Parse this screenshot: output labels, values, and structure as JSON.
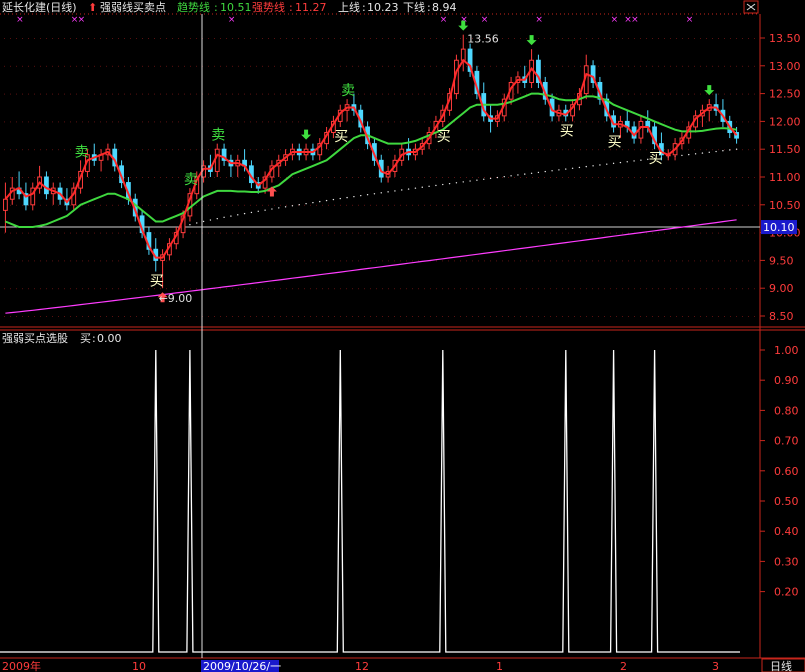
{
  "header": {
    "stock_title": "延长化建(日线)",
    "indicator_name": "强弱线买卖点",
    "trend_label": "趋势线",
    "trend_value": "10.51",
    "strong_label": "强势线",
    "strong_value": "11.27",
    "upper_label": "上线",
    "upper_value": "10.23",
    "lower_label": "下线",
    "lower_value": "8.94"
  },
  "lower_header": {
    "indicator_name": "强弱买点选股",
    "buy_label": "买",
    "buy_value": "0.00"
  },
  "bottom_bar": {
    "x_labels": [
      "2009年",
      "10",
      "2009/10/26/一",
      "12",
      "1",
      "2",
      "3"
    ],
    "period_label": "日线"
  },
  "colors": {
    "background": "#000000",
    "axis": "#c8261c",
    "up_candle": "#ff3c3c",
    "down_candle": "#4fd8ff",
    "trend_line": "#3fd83f",
    "strong_line": "#ff2a2a",
    "long_ma": "#ff3cff",
    "signal_line": "#ffffff",
    "buy_text": "#ffffc8",
    "sell_text": "#40e040"
  },
  "chart_data": [
    {
      "type": "candlestick",
      "ylim": [
        8.3,
        13.7
      ],
      "y_ticks": [
        "13.50",
        "13.00",
        "12.50",
        "12.00",
        "11.50",
        "11.00",
        "10.50",
        "10.00",
        "9.50",
        "9.00",
        "8.50"
      ],
      "current_price_label": "10.10",
      "annotations": {
        "high_label": "13.56",
        "low_label": "9.00",
        "sell_label": "卖",
        "buy_label": "买"
      },
      "ohlc": [
        [
          10.4,
          10.9,
          10.0,
          10.6
        ],
        [
          10.6,
          11.0,
          10.5,
          10.8
        ],
        [
          10.8,
          11.1,
          10.6,
          10.7
        ],
        [
          10.7,
          10.9,
          10.4,
          10.5
        ],
        [
          10.5,
          10.9,
          10.4,
          10.8
        ],
        [
          10.8,
          11.2,
          10.7,
          11.0
        ],
        [
          11.0,
          11.1,
          10.6,
          10.7
        ],
        [
          10.7,
          10.9,
          10.5,
          10.8
        ],
        [
          10.8,
          10.9,
          10.5,
          10.6
        ],
        [
          10.6,
          10.8,
          10.4,
          10.5
        ],
        [
          10.5,
          10.9,
          10.4,
          10.8
        ],
        [
          10.8,
          11.3,
          10.7,
          11.1
        ],
        [
          11.1,
          11.5,
          11.0,
          11.4
        ],
        [
          11.4,
          11.6,
          11.2,
          11.3
        ],
        [
          11.3,
          11.5,
          11.1,
          11.4
        ],
        [
          11.4,
          11.6,
          11.3,
          11.5
        ],
        [
          11.5,
          11.6,
          11.1,
          11.2
        ],
        [
          11.2,
          11.3,
          10.8,
          10.9
        ],
        [
          10.9,
          11.0,
          10.5,
          10.6
        ],
        [
          10.6,
          10.7,
          10.2,
          10.3
        ],
        [
          10.3,
          10.4,
          9.9,
          10.0
        ],
        [
          10.0,
          10.1,
          9.6,
          9.7
        ],
        [
          9.7,
          9.9,
          9.3,
          9.5
        ],
        [
          9.5,
          9.7,
          9.0,
          9.6
        ],
        [
          9.6,
          9.9,
          9.5,
          9.8
        ],
        [
          9.8,
          10.1,
          9.7,
          10.0
        ],
        [
          10.0,
          10.4,
          9.9,
          10.3
        ],
        [
          10.3,
          10.8,
          10.2,
          10.7
        ],
        [
          10.7,
          11.1,
          10.6,
          11.0
        ],
        [
          11.0,
          11.3,
          10.9,
          11.2
        ],
        [
          11.2,
          11.4,
          11.0,
          11.1
        ],
        [
          11.1,
          11.6,
          11.0,
          11.5
        ],
        [
          11.5,
          11.6,
          11.2,
          11.3
        ],
        [
          11.3,
          11.4,
          11.0,
          11.2
        ],
        [
          11.2,
          11.4,
          11.0,
          11.3
        ],
        [
          11.3,
          11.5,
          11.1,
          11.2
        ],
        [
          11.2,
          11.3,
          10.8,
          10.9
        ],
        [
          10.9,
          11.0,
          10.7,
          10.8
        ],
        [
          10.8,
          11.1,
          10.7,
          11.0
        ],
        [
          11.0,
          11.3,
          10.9,
          11.2
        ],
        [
          11.2,
          11.4,
          11.0,
          11.3
        ],
        [
          11.3,
          11.5,
          11.2,
          11.4
        ],
        [
          11.4,
          11.6,
          11.3,
          11.5
        ],
        [
          11.5,
          11.6,
          11.3,
          11.4
        ],
        [
          11.4,
          11.6,
          11.3,
          11.5
        ],
        [
          11.5,
          11.6,
          11.3,
          11.4
        ],
        [
          11.4,
          11.7,
          11.3,
          11.6
        ],
        [
          11.6,
          11.9,
          11.5,
          11.8
        ],
        [
          11.8,
          12.1,
          11.7,
          12.0
        ],
        [
          12.0,
          12.3,
          11.9,
          12.2
        ],
        [
          12.2,
          12.4,
          12.0,
          12.3
        ],
        [
          12.3,
          12.5,
          12.1,
          12.2
        ],
        [
          12.2,
          12.3,
          11.8,
          11.9
        ],
        [
          11.9,
          12.0,
          11.5,
          11.6
        ],
        [
          11.6,
          11.7,
          11.2,
          11.3
        ],
        [
          11.3,
          11.4,
          10.9,
          11.0
        ],
        [
          11.0,
          11.2,
          10.9,
          11.1
        ],
        [
          11.1,
          11.4,
          11.0,
          11.3
        ],
        [
          11.3,
          11.6,
          11.2,
          11.5
        ],
        [
          11.5,
          11.7,
          11.3,
          11.4
        ],
        [
          11.4,
          11.6,
          11.3,
          11.5
        ],
        [
          11.5,
          11.7,
          11.4,
          11.6
        ],
        [
          11.6,
          11.9,
          11.5,
          11.8
        ],
        [
          11.8,
          12.1,
          11.7,
          12.0
        ],
        [
          12.0,
          12.3,
          11.9,
          12.2
        ],
        [
          12.2,
          12.6,
          12.1,
          12.5
        ],
        [
          12.5,
          13.2,
          12.4,
          13.1
        ],
        [
          13.1,
          13.56,
          12.9,
          13.3
        ],
        [
          13.3,
          13.4,
          12.8,
          12.9
        ],
        [
          12.9,
          13.0,
          12.4,
          12.5
        ],
        [
          12.5,
          12.7,
          12.0,
          12.1
        ],
        [
          12.1,
          12.3,
          11.8,
          12.0
        ],
        [
          12.0,
          12.2,
          11.9,
          12.1
        ],
        [
          12.1,
          12.5,
          12.0,
          12.4
        ],
        [
          12.4,
          12.8,
          12.3,
          12.7
        ],
        [
          12.7,
          12.9,
          12.5,
          12.8
        ],
        [
          12.8,
          13.0,
          12.6,
          12.7
        ],
        [
          12.7,
          13.3,
          12.6,
          13.1
        ],
        [
          13.1,
          13.2,
          12.6,
          12.7
        ],
        [
          12.7,
          12.8,
          12.3,
          12.4
        ],
        [
          12.4,
          12.5,
          12.0,
          12.1
        ],
        [
          12.1,
          12.3,
          12.0,
          12.2
        ],
        [
          12.2,
          12.3,
          12.0,
          12.1
        ],
        [
          12.1,
          12.4,
          12.0,
          12.3
        ],
        [
          12.3,
          12.6,
          12.2,
          12.5
        ],
        [
          12.5,
          13.2,
          12.4,
          13.0
        ],
        [
          13.0,
          13.1,
          12.6,
          12.7
        ],
        [
          12.7,
          12.8,
          12.3,
          12.4
        ],
        [
          12.4,
          12.5,
          12.0,
          12.1
        ],
        [
          12.1,
          12.2,
          11.8,
          11.9
        ],
        [
          11.9,
          12.1,
          11.7,
          12.0
        ],
        [
          12.0,
          12.2,
          11.8,
          11.9
        ],
        [
          11.9,
          12.0,
          11.6,
          11.7
        ],
        [
          11.7,
          12.1,
          11.6,
          12.0
        ],
        [
          12.0,
          12.2,
          11.8,
          11.9
        ],
        [
          11.9,
          12.0,
          11.5,
          11.6
        ],
        [
          11.6,
          11.8,
          11.3,
          11.4
        ],
        [
          11.4,
          11.5,
          11.3,
          11.4
        ],
        [
          11.4,
          11.7,
          11.3,
          11.6
        ],
        [
          11.6,
          11.8,
          11.5,
          11.7
        ],
        [
          11.7,
          12.0,
          11.6,
          11.9
        ],
        [
          11.9,
          12.2,
          11.8,
          12.1
        ],
        [
          12.1,
          12.3,
          11.9,
          12.2
        ],
        [
          12.2,
          12.4,
          12.0,
          12.3
        ],
        [
          12.3,
          12.5,
          12.1,
          12.2
        ],
        [
          12.2,
          12.4,
          11.9,
          12.0
        ],
        [
          12.0,
          12.1,
          11.7,
          11.8
        ],
        [
          11.8,
          11.9,
          11.6,
          11.7
        ]
      ],
      "trend_line": [
        10.2,
        10.15,
        10.1,
        10.1,
        10.1,
        10.12,
        10.15,
        10.2,
        10.25,
        10.3,
        10.4,
        10.5,
        10.55,
        10.6,
        10.65,
        10.7,
        10.7,
        10.65,
        10.6,
        10.5,
        10.4,
        10.3,
        10.2,
        10.2,
        10.25,
        10.3,
        10.35,
        10.45,
        10.55,
        10.65,
        10.7,
        10.75,
        10.75,
        10.75,
        10.74,
        10.74,
        10.73,
        10.73,
        10.75,
        10.8,
        10.85,
        10.95,
        11.05,
        11.1,
        11.15,
        11.2,
        11.25,
        11.3,
        11.4,
        11.5,
        11.6,
        11.7,
        11.75,
        11.75,
        11.7,
        11.65,
        11.6,
        11.6,
        11.6,
        11.62,
        11.65,
        11.7,
        11.75,
        11.8,
        11.85,
        11.95,
        12.05,
        12.15,
        12.25,
        12.3,
        12.3,
        12.3,
        12.3,
        12.32,
        12.35,
        12.4,
        12.45,
        12.5,
        12.5,
        12.48,
        12.45,
        12.4,
        12.38,
        12.38,
        12.4,
        12.45,
        12.45,
        12.42,
        12.38,
        12.3,
        12.25,
        12.2,
        12.15,
        12.1,
        12.05,
        12.0,
        11.95,
        11.9,
        11.85,
        11.82,
        11.82,
        11.82,
        11.83,
        11.85,
        11.87,
        11.88,
        11.87,
        11.85
      ],
      "strong_line": [
        10.6,
        10.75,
        10.8,
        10.65,
        10.7,
        10.9,
        10.8,
        10.75,
        10.7,
        10.55,
        10.7,
        11.0,
        11.3,
        11.35,
        11.4,
        11.45,
        11.3,
        11.0,
        10.7,
        10.4,
        10.05,
        9.75,
        9.55,
        9.55,
        9.75,
        9.95,
        10.25,
        10.6,
        10.95,
        11.15,
        11.15,
        11.4,
        11.35,
        11.25,
        11.25,
        11.2,
        11.0,
        10.85,
        10.95,
        11.15,
        11.25,
        11.35,
        11.45,
        11.45,
        11.45,
        11.45,
        11.55,
        11.75,
        11.95,
        12.15,
        12.25,
        12.25,
        12.0,
        11.7,
        11.4,
        11.1,
        11.05,
        11.2,
        11.4,
        11.45,
        11.45,
        11.55,
        11.7,
        11.9,
        12.1,
        12.4,
        12.9,
        13.1,
        13.0,
        12.6,
        12.2,
        12.05,
        12.05,
        12.3,
        12.6,
        12.75,
        12.75,
        12.95,
        12.8,
        12.5,
        12.2,
        12.15,
        12.12,
        12.25,
        12.45,
        12.85,
        12.8,
        12.5,
        12.2,
        11.95,
        11.95,
        11.9,
        11.75,
        11.9,
        11.9,
        11.65,
        11.45,
        11.4,
        11.5,
        11.65,
        11.85,
        12.05,
        12.15,
        12.25,
        12.25,
        12.1,
        11.9,
        11.75
      ],
      "long_ma_range": [
        8.55,
        10.23
      ],
      "dotted_support_range": [
        10.1,
        11.5
      ],
      "buy_signal_bars": [
        22,
        49,
        64,
        82,
        89,
        95
      ],
      "sell_signal_bars": [
        11,
        27,
        31,
        50
      ],
      "green_down_arrow_bars": [
        44,
        67,
        77,
        103
      ],
      "red_up_arrow_bars": [
        23,
        39
      ],
      "magenta_x_bars": [
        2,
        10,
        11,
        33,
        64,
        67,
        70,
        78,
        89,
        91,
        92,
        100
      ]
    },
    {
      "type": "line",
      "name": "强弱买点选股",
      "ylim": [
        0,
        1.05
      ],
      "y_ticks": [
        "1.00",
        "0.90",
        "0.80",
        "0.70",
        "0.60",
        "0.50",
        "0.40",
        "0.30",
        "0.20"
      ],
      "spike_bars": [
        22,
        27,
        49,
        64,
        82,
        89,
        95
      ],
      "n_bars": 108
    }
  ]
}
